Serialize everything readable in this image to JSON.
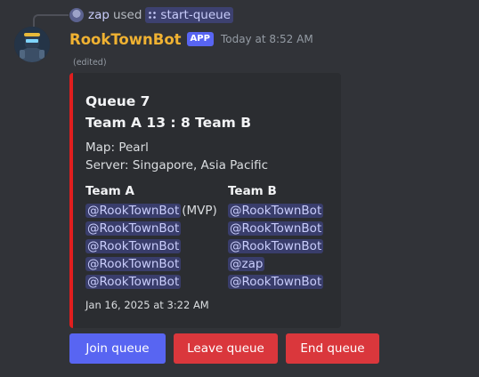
{
  "interaction": {
    "user": "zap",
    "used": "used",
    "command": "start-queue"
  },
  "author": {
    "name": "RookTownBot",
    "badge": "APP",
    "timestamp": "Today at 8:52 AM",
    "edited": "(edited)"
  },
  "embed": {
    "accent_color": "#e01e1e",
    "title_line1": "Queue 7",
    "title_line2": "Team A 13 : 8 Team B",
    "map": "Map: Pearl",
    "server": "Server: Singapore, Asia Pacific",
    "team_a": {
      "name": "Team A",
      "players": [
        "@RookTownBot",
        "@RookTownBot",
        "@RookTownBot",
        "@RookTownBot",
        "@RookTownBot"
      ],
      "mvp_label": "(MVP)"
    },
    "team_b": {
      "name": "Team B",
      "players": [
        "@RookTownBot",
        "@RookTownBot",
        "@RookTownBot",
        "@zap",
        "@RookTownBot"
      ]
    },
    "footer": "Jan 16, 2025 at 3:22 AM"
  },
  "buttons": {
    "join": "Join queue",
    "leave": "Leave queue",
    "end": "End queue"
  },
  "colors": {
    "background": "#313338",
    "embed_bg": "#2b2d31",
    "username": "#f0b232",
    "primary_button": "#5865f2",
    "danger_button": "#da373c",
    "mention_text": "#c9cdfb"
  },
  "icons": {
    "command": "slash-command-icon",
    "avatar": "bot-avatar"
  }
}
